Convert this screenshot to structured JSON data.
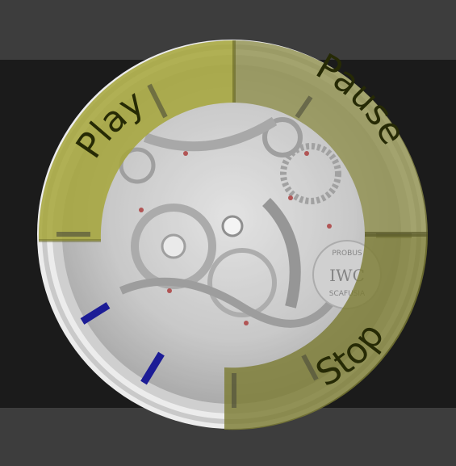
{
  "menu": {
    "play_label": "Play",
    "pause_label": "Pause",
    "stop_label": "Stop"
  },
  "colors": {
    "play_segment": "#a6a63a",
    "pause_segment": "#8e8e4a",
    "stop_segment": "#7d7d35",
    "empty_segment": "#ececec",
    "accent_blue": "#1c1c96"
  },
  "watch_face": {
    "brand_text": "IWC",
    "engraving_top": "PROBUS",
    "engraving_bottom": "SCAFUSIA"
  }
}
